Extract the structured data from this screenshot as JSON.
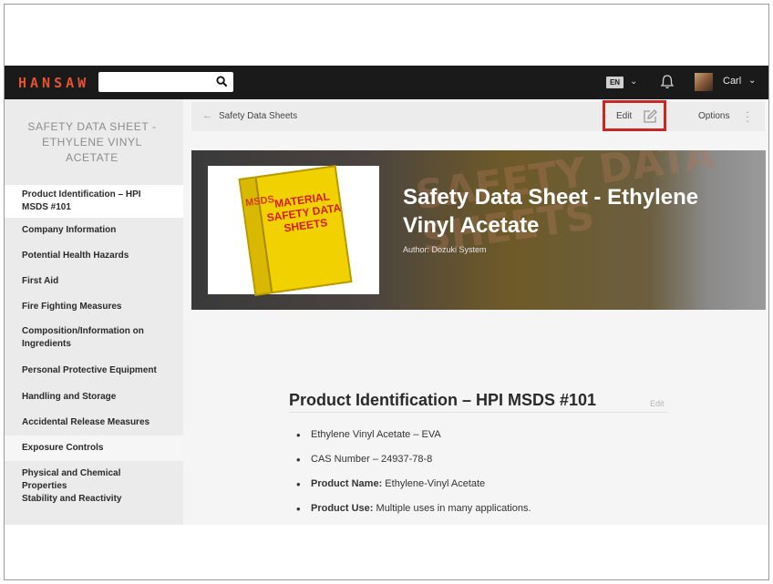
{
  "header": {
    "logo": "HANSAW",
    "search": {
      "value": "",
      "placeholder": ""
    },
    "language": "EN",
    "user_name": "Carl"
  },
  "sidebar": {
    "title": "SAFETY DATA SHEET - ETHYLENE VINYL ACETATE",
    "items": [
      {
        "label": "Product Identification – HPI MSDS #101",
        "active": true
      },
      {
        "label": "Company Information"
      },
      {
        "label": "Potential Health Hazards"
      },
      {
        "label": "First Aid"
      },
      {
        "label": "Fire Fighting Measures"
      },
      {
        "label": "Composition/Information on Ingredients"
      },
      {
        "label": "Personal Protective Equipment"
      },
      {
        "label": "Handling and Storage"
      },
      {
        "label": "Accidental Release Measures"
      },
      {
        "label": "Exposure Controls",
        "highlight": true
      },
      {
        "label": "Physical and Chemical Properties"
      },
      {
        "label": "Stability and Reactivity"
      }
    ]
  },
  "toolbar": {
    "breadcrumb": "Safety Data Sheets",
    "edit_label": "Edit",
    "options_label": "Options"
  },
  "hero": {
    "title": "Safety Data Sheet - Ethylene Vinyl Acetate",
    "author": "Author: Dozuki System",
    "watermark": "SAFETY DATA SHEETS",
    "binder_spine": "MSDS",
    "binder_text": "MATERIAL SAFETY DATA SHEETS"
  },
  "section": {
    "title": "Product Identification – HPI MSDS #101",
    "edit_label": "Edit",
    "bullets": [
      {
        "bold": "",
        "text": "Ethylene Vinyl Acetate – EVA"
      },
      {
        "bold": "",
        "text": "CAS Number – 24937-78-8"
      },
      {
        "bold": "Product Name:",
        "text": " Ethylene-Vinyl Acetate"
      },
      {
        "bold": "Product Use:",
        "text": " Multiple uses in many applications."
      }
    ]
  },
  "colors": {
    "topbar": "#1a1a1a",
    "logo": "#e8532e",
    "highlight_border": "#c62828",
    "binder": "#f1d200"
  },
  "icons": [
    "search-icon",
    "chevron-down-icon",
    "bell-icon",
    "back-arrow-icon",
    "edit-pencil-icon",
    "more-vertical-icon"
  ]
}
